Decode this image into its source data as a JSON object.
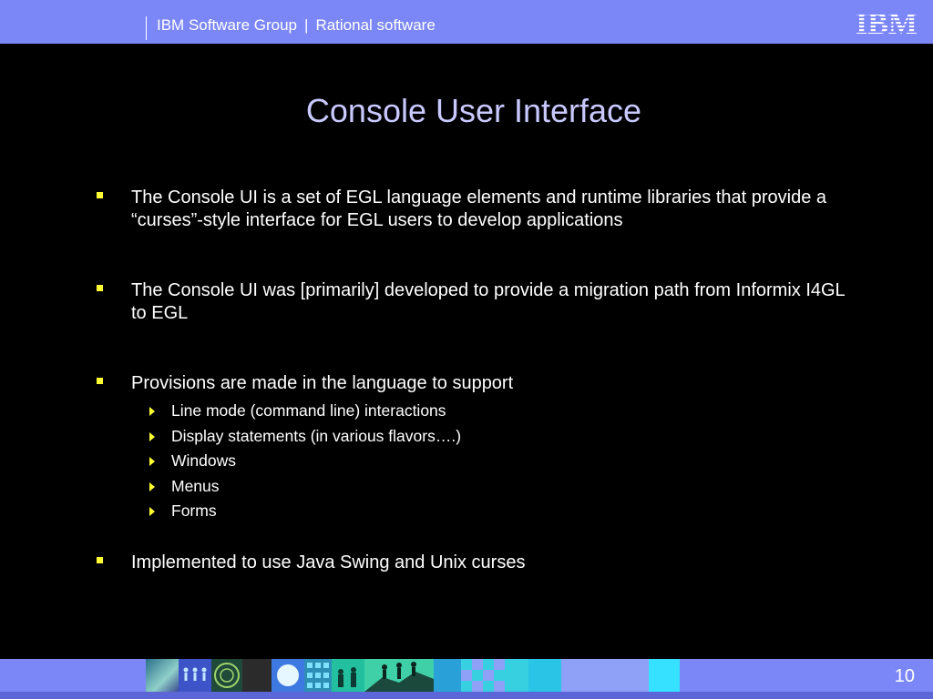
{
  "header": {
    "group": "IBM Software Group",
    "separator": "|",
    "division": "Rational software",
    "logo_text": "IBM",
    "band_color": "#7c87f7"
  },
  "title": "Console User Interface",
  "accent_color": "#ffff33",
  "title_color": "#c9c9ff",
  "bullets": [
    {
      "text": "The Console UI is a set of EGL language elements and runtime libraries that provide a “curses”-style interface for EGL users to develop applications"
    },
    {
      "text": "The Console UI was [primarily] developed to provide a migration path from Informix I4GL to EGL"
    },
    {
      "text": "Provisions are made in the language to support",
      "subitems": [
        "Line mode (command line) interactions",
        "Display statements (in various flavors….)",
        "Windows",
        "Menus",
        "Forms"
      ]
    },
    {
      "text": "Implemented to use Java Swing and Unix curses"
    }
  ],
  "footer": {
    "page_number": "10"
  }
}
